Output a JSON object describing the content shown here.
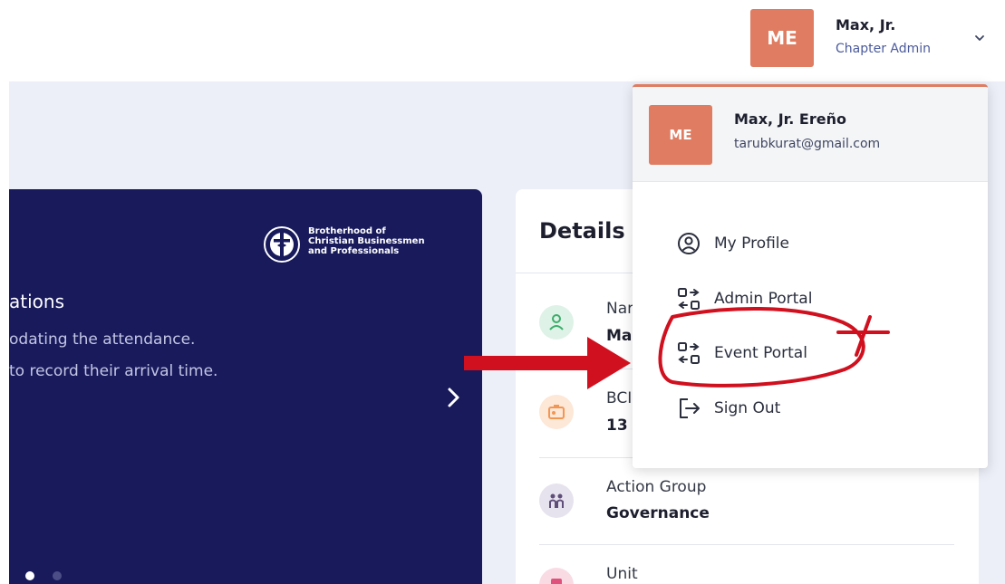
{
  "header": {
    "avatar_initials": "ME",
    "user_name": "Max, Jr.",
    "user_role": "Chapter Admin",
    "menu_toggle_icon": "chevron-down-icon"
  },
  "banner": {
    "org_line_1": "Brotherhood of",
    "org_line_2": "Christian Businessmen",
    "org_line_3": "and Professionals",
    "title": "ations",
    "text_line_1": "odating the attendance.",
    "text_line_2": "to record their arrival time.",
    "next_icon": "chevron-right-icon",
    "slides": 2,
    "active_slide": 1
  },
  "details": {
    "title": "Details",
    "rows": [
      {
        "label": "Nar",
        "value": "Ma",
        "icon": "user-icon"
      },
      {
        "label": "BCI",
        "value": "13",
        "icon": "id-card-icon"
      },
      {
        "label": "Action Group",
        "value": "Governance",
        "icon": "group-icon"
      },
      {
        "label": "Unit",
        "value": "",
        "icon": "unit-icon"
      }
    ]
  },
  "dropdown": {
    "avatar_initials": "ME",
    "full_name": "Max, Jr. Ereño",
    "email": "tarubkurat@gmail.com",
    "items": [
      {
        "label": "My Profile",
        "icon": "user-circle-icon"
      },
      {
        "label": "Admin Portal",
        "icon": "switch-portal-icon"
      },
      {
        "label": "Event Portal",
        "icon": "switch-portal-icon"
      },
      {
        "label": "Sign Out",
        "icon": "sign-out-icon"
      }
    ]
  },
  "colors": {
    "accent": "#df7c61",
    "banner_bg": "#181a5c",
    "page_bg": "#eceef8",
    "annotation_red": "#d0101e"
  }
}
